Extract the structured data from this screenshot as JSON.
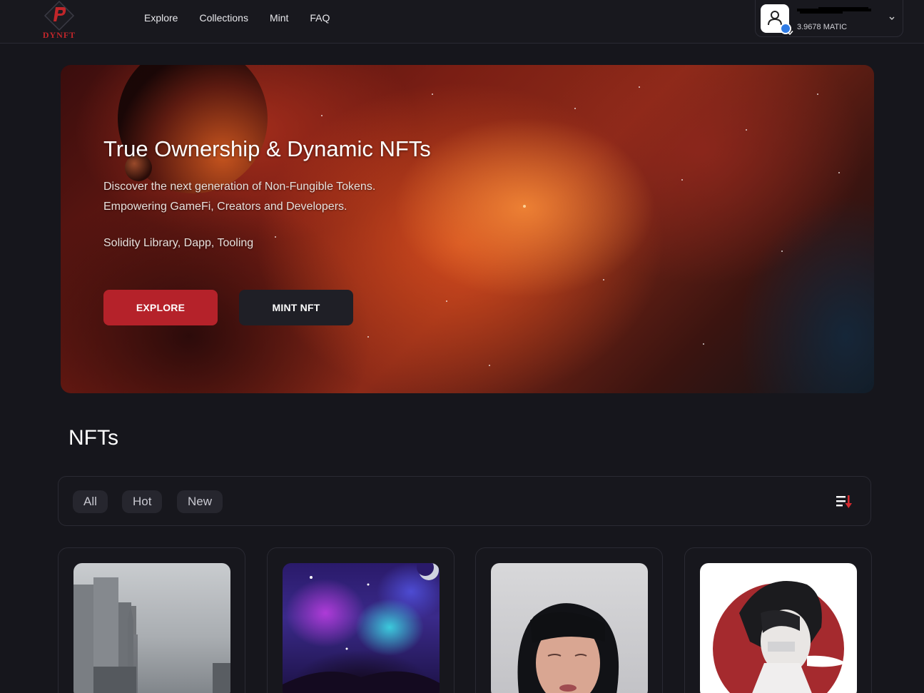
{
  "brand": {
    "logo_text": "DYNFT",
    "accent": "#c0262a"
  },
  "nav": {
    "items": [
      {
        "label": "Explore"
      },
      {
        "label": "Collections"
      },
      {
        "label": "Mint"
      },
      {
        "label": "FAQ"
      }
    ]
  },
  "wallet": {
    "balance": "3.9678 MATIC",
    "avatar_icon": "user-icon",
    "verified_icon": "check-badge-icon"
  },
  "hero": {
    "title": "True Ownership & Dynamic NFTs",
    "subtitle_line1": "Discover the next generation of Non-Fungible Tokens.",
    "subtitle_line2": "Empowering GameFi, Creators and Developers.",
    "tagline": "Solidity Library, Dapp, Tooling",
    "explore_label": "EXPLORE",
    "mint_label": "MINT NFT"
  },
  "nfts": {
    "title": "NFTs",
    "filters": [
      {
        "label": "All"
      },
      {
        "label": "Hot"
      },
      {
        "label": "New"
      }
    ],
    "sort_icon": "sort-descending-icon"
  },
  "colors": {
    "background": "#16161c",
    "primary_button": "#b5222a",
    "secondary_button": "#1f1f26"
  }
}
